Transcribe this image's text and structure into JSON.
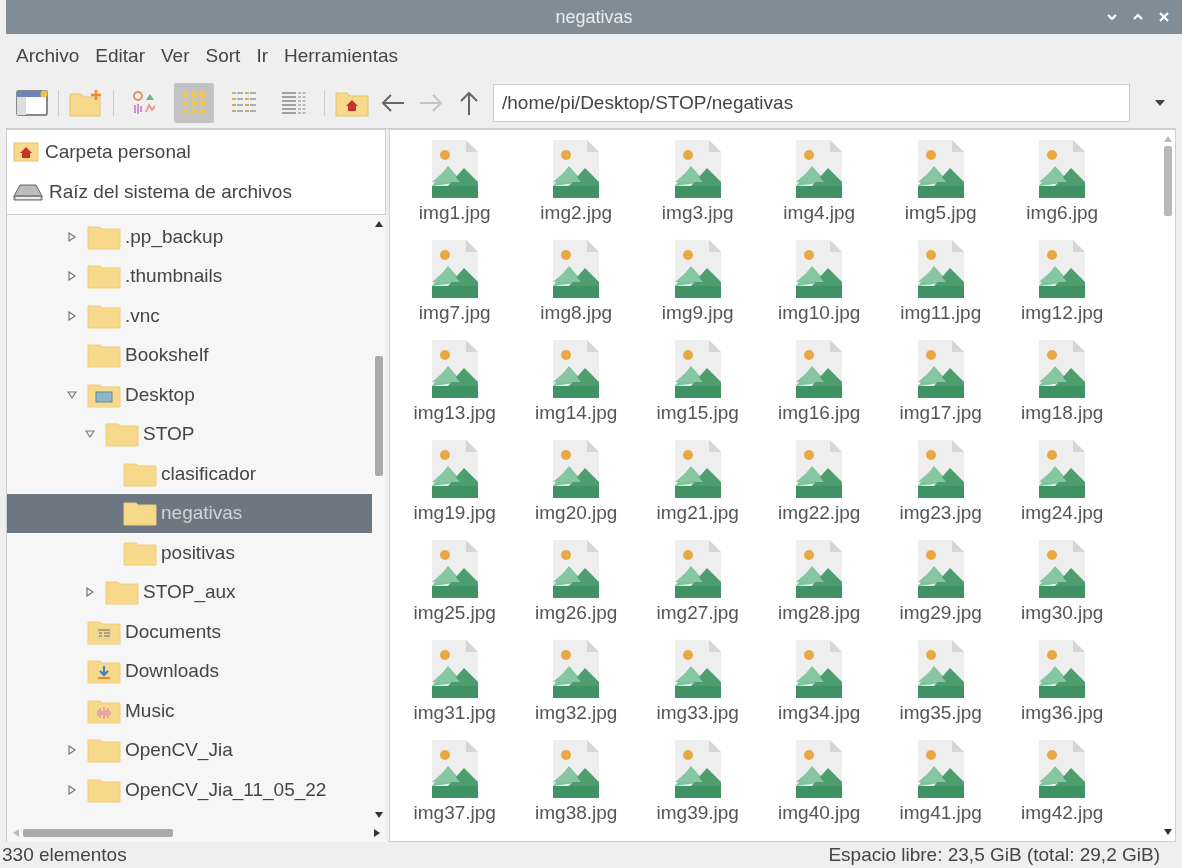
{
  "window": {
    "title": "negativas"
  },
  "menu": [
    "Archivo",
    "Editar",
    "Ver",
    "Sort",
    "Ir",
    "Herramientas"
  ],
  "toolbar": {
    "view_modes": [
      {
        "kind": "thumbnail",
        "selected": false
      },
      {
        "kind": "icons",
        "selected": true
      },
      {
        "kind": "compact",
        "selected": false
      },
      {
        "kind": "list",
        "selected": false
      }
    ],
    "navigation": [
      {
        "kind": "back",
        "disabled": false
      },
      {
        "kind": "forward",
        "disabled": true
      },
      {
        "kind": "up",
        "disabled": false
      }
    ],
    "path": "/home/pi/Desktop/STOP/negativas"
  },
  "sidebar": {
    "places": [
      {
        "kind": "home",
        "label": "Carpeta personal"
      },
      {
        "kind": "drive",
        "label": "Raíz del sistema de archivos"
      }
    ],
    "tree": [
      {
        "name": ".pp_backup",
        "kind": "folder",
        "expanded": false,
        "selected": false
      },
      {
        "name": ".thumbnails",
        "kind": "folder",
        "expanded": false,
        "selected": false
      },
      {
        "name": ".vnc",
        "kind": "folder",
        "expanded": false,
        "selected": false
      },
      {
        "name": "Bookshelf",
        "kind": "folder",
        "selected": false
      },
      {
        "name": "Desktop",
        "kind": "desktop",
        "expanded": true,
        "selected": false,
        "children": [
          {
            "name": "STOP",
            "kind": "folder",
            "expanded": true,
            "selected": false,
            "children": [
              {
                "name": "clasificador",
                "kind": "folder",
                "selected": false
              },
              {
                "name": "negativas",
                "kind": "folder",
                "selected": true
              },
              {
                "name": "positivas",
                "kind": "folder",
                "selected": false
              }
            ]
          },
          {
            "name": "STOP_aux",
            "kind": "folder",
            "expanded": false,
            "selected": false
          }
        ]
      },
      {
        "name": "Documents",
        "kind": "documents",
        "selected": false
      },
      {
        "name": "Downloads",
        "kind": "downloads",
        "selected": false
      },
      {
        "name": "Music",
        "kind": "music",
        "selected": false
      },
      {
        "name": "OpenCV_Jia",
        "kind": "folder",
        "expanded": false,
        "selected": false
      },
      {
        "name": "OpenCV_Jia_11_05_22",
        "kind": "folder",
        "expanded": false,
        "selected": false
      }
    ]
  },
  "files": [
    "img1.jpg",
    "img2.jpg",
    "img3.jpg",
    "img4.jpg",
    "img5.jpg",
    "img6.jpg",
    "img7.jpg",
    "img8.jpg",
    "img9.jpg",
    "img10.jpg",
    "img11.jpg",
    "img12.jpg",
    "img13.jpg",
    "img14.jpg",
    "img15.jpg",
    "img16.jpg",
    "img17.jpg",
    "img18.jpg",
    "img19.jpg",
    "img20.jpg",
    "img21.jpg",
    "img22.jpg",
    "img23.jpg",
    "img24.jpg",
    "img25.jpg",
    "img26.jpg",
    "img27.jpg",
    "img28.jpg",
    "img29.jpg",
    "img30.jpg",
    "img31.jpg",
    "img32.jpg",
    "img33.jpg",
    "img34.jpg",
    "img35.jpg",
    "img36.jpg",
    "img37.jpg",
    "img38.jpg",
    "img39.jpg",
    "img40.jpg",
    "img41.jpg",
    "img42.jpg"
  ],
  "status_bar": {
    "count": "330 elementos",
    "free_space": "Espacio libre: 23,5 GiB (total: 29,2 GiB)"
  }
}
